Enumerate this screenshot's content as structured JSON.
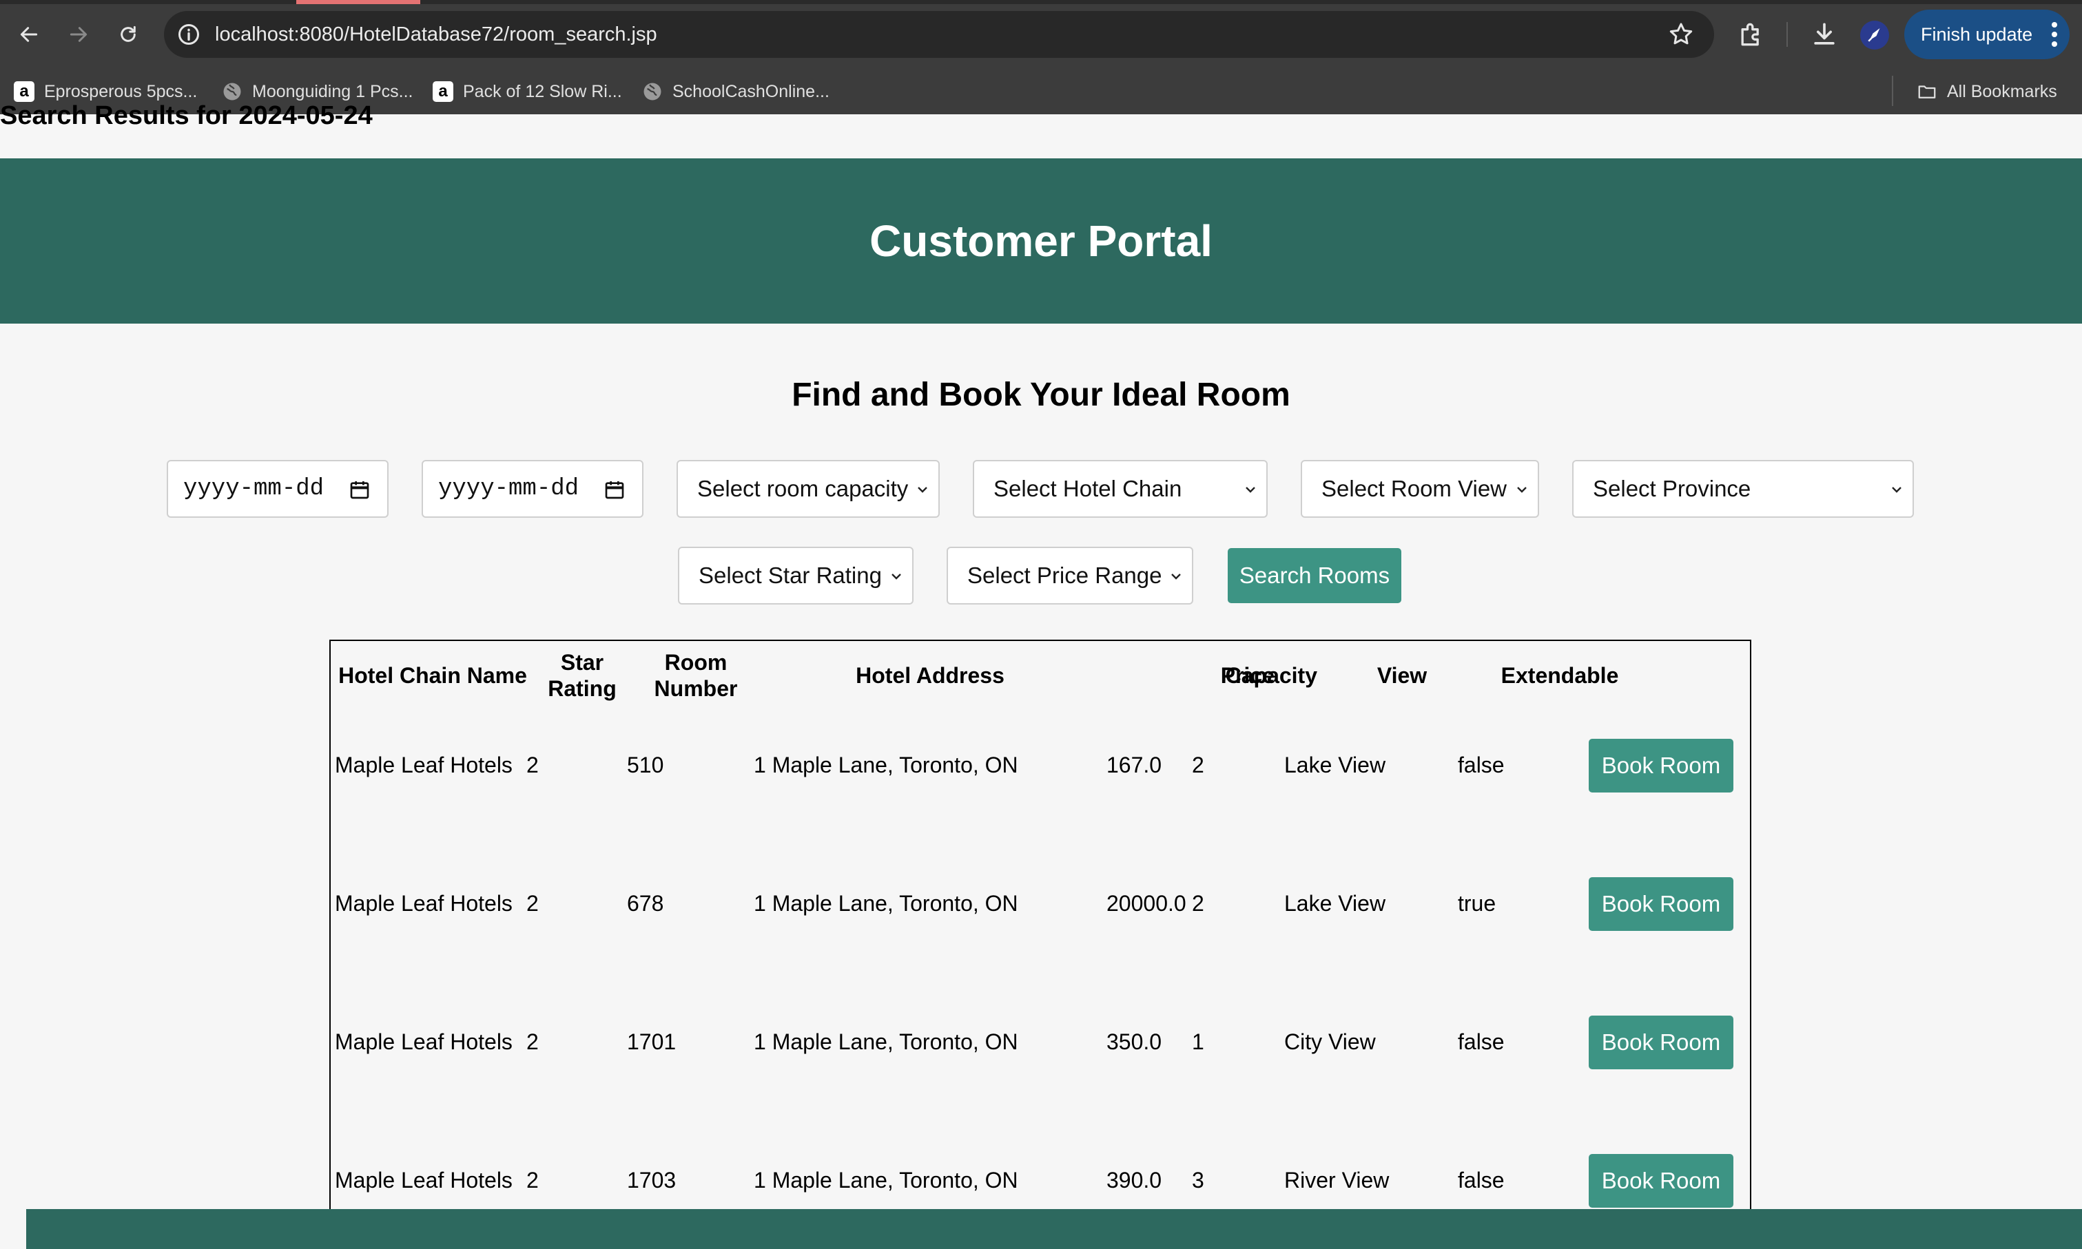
{
  "browser": {
    "url": "localhost:8080/HotelDatabase72/room_search.jsp",
    "finish_update_label": "Finish update",
    "bookmarks": [
      {
        "label": "Eprosperous 5pcs...",
        "icon": "amazon-icon"
      },
      {
        "label": "Moonguiding 1 Pcs...",
        "icon": "globe-icon"
      },
      {
        "label": "Pack of 12 Slow Ri...",
        "icon": "amazon-icon"
      },
      {
        "label": "SchoolCashOnline...",
        "icon": "globe-icon"
      }
    ],
    "all_bookmarks_label": "All Bookmarks"
  },
  "page": {
    "search_results_heading": "Search Results for 2024-05-24",
    "portal_title": "Customer Portal",
    "find_heading": "Find and Book Your Ideal Room",
    "filters": {
      "check_in_placeholder": "yyyy-mm-dd",
      "check_out_placeholder": "yyyy-mm-dd",
      "capacity": "Select room capacity",
      "hotel_chain": "Select Hotel Chain",
      "room_view": "Select Room View",
      "province": "Select Province",
      "star_rating": "Select Star Rating",
      "price_range": "Select Price Range",
      "search_button": "Search Rooms"
    },
    "table": {
      "headers": {
        "chain": "Hotel Chain Name",
        "star": "Star Rating",
        "room": "Room Number",
        "address": "Hotel Address",
        "price": "Price",
        "capacity": "Capacity",
        "view": "View",
        "extendable": "Extendable"
      },
      "book_label": "Book Room",
      "rows": [
        {
          "chain": "Maple Leaf Hotels",
          "star": "2",
          "room": "510",
          "address": "1 Maple Lane, Toronto, ON",
          "price": "167.0",
          "capacity": "2",
          "view": "Lake View",
          "extendable": "false"
        },
        {
          "chain": "Maple Leaf Hotels",
          "star": "2",
          "room": "678",
          "address": "1 Maple Lane, Toronto, ON",
          "price": "20000.0",
          "capacity": "2",
          "view": "Lake View",
          "extendable": "true"
        },
        {
          "chain": "Maple Leaf Hotels",
          "star": "2",
          "room": "1701",
          "address": "1 Maple Lane, Toronto, ON",
          "price": "350.0",
          "capacity": "1",
          "view": "City View",
          "extendable": "false"
        },
        {
          "chain": "Maple Leaf Hotels",
          "star": "2",
          "room": "1703",
          "address": "1 Maple Lane, Toronto, ON",
          "price": "390.0",
          "capacity": "3",
          "view": "River View",
          "extendable": "false"
        }
      ]
    }
  },
  "colors": {
    "brand_green": "#2d695f",
    "button_teal": "#3d9484",
    "update_blue": "#1b4f86"
  }
}
